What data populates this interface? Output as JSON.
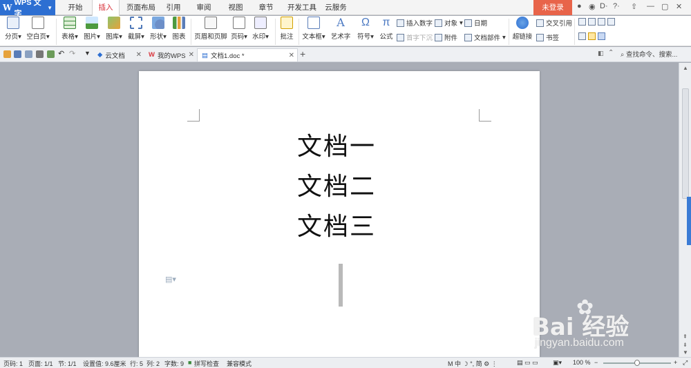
{
  "app": {
    "name": "WPS 文字",
    "logo": "W"
  },
  "menu_tabs": [
    "开始",
    "插入",
    "页面布局",
    "引用",
    "审阅",
    "视图",
    "章节",
    "开发工具",
    "云服务"
  ],
  "active_tab": "插入",
  "login_label": "未登录",
  "ribbon": {
    "large_buttons": [
      {
        "label": "分页",
        "icon": "page-break-icon"
      },
      {
        "label": "空白页",
        "icon": "blank-page-icon"
      },
      {
        "label": "表格",
        "icon": "table-icon"
      },
      {
        "label": "图片",
        "icon": "picture-icon"
      },
      {
        "label": "图库",
        "icon": "gallery-icon"
      },
      {
        "label": "截屏",
        "icon": "screenshot-icon"
      },
      {
        "label": "形状",
        "icon": "shape-icon"
      },
      {
        "label": "图表",
        "icon": "chart-icon"
      },
      {
        "label": "页眉和页脚",
        "icon": "header-footer-icon"
      },
      {
        "label": "页码",
        "icon": "page-number-icon"
      },
      {
        "label": "水印",
        "icon": "watermark-icon"
      },
      {
        "label": "批注",
        "icon": "comment-icon"
      },
      {
        "label": "文本框",
        "icon": "textbox-icon"
      },
      {
        "label": "艺术字",
        "icon": "wordart-icon"
      },
      {
        "label": "符号",
        "icon": "symbol-icon"
      },
      {
        "label": "公式",
        "icon": "formula-icon"
      },
      {
        "label": "超链接",
        "icon": "hyperlink-icon"
      }
    ],
    "small_buttons": {
      "insert_number": "插入数字",
      "object": "对象",
      "date": "日期",
      "drop_cap": "首字下沉",
      "attachment": "附件",
      "doc_parts": "文档部件",
      "cross_ref": "交叉引用",
      "bookmark": "书签"
    }
  },
  "doc_tabs": [
    {
      "label": "云文档",
      "active": false
    },
    {
      "label": "我的WPS",
      "active": false
    },
    {
      "label": "文档1.doc *",
      "active": true
    }
  ],
  "search_placeholder": "查找命令、搜索...",
  "document": {
    "lines": [
      "文档一",
      "文档二",
      "文档三"
    ]
  },
  "status": {
    "page": "页码: 1",
    "pages": "页面: 1/1",
    "section": "节: 1/1",
    "position": "设置值: 9.6厘米",
    "row": "行: 5",
    "col": "列: 2",
    "words": "字数: 9",
    "spell": "拼写检查",
    "compat": "兼容模式",
    "zoom": "100 %",
    "zoom_level": 0.5
  },
  "watermark": {
    "main": "Bai 经验",
    "sub": "jingyan.baidu.com"
  },
  "colors": {
    "brand": "#2d6fd2",
    "active_tab_text": "#d9363e",
    "login_bg": "#e8644a"
  }
}
